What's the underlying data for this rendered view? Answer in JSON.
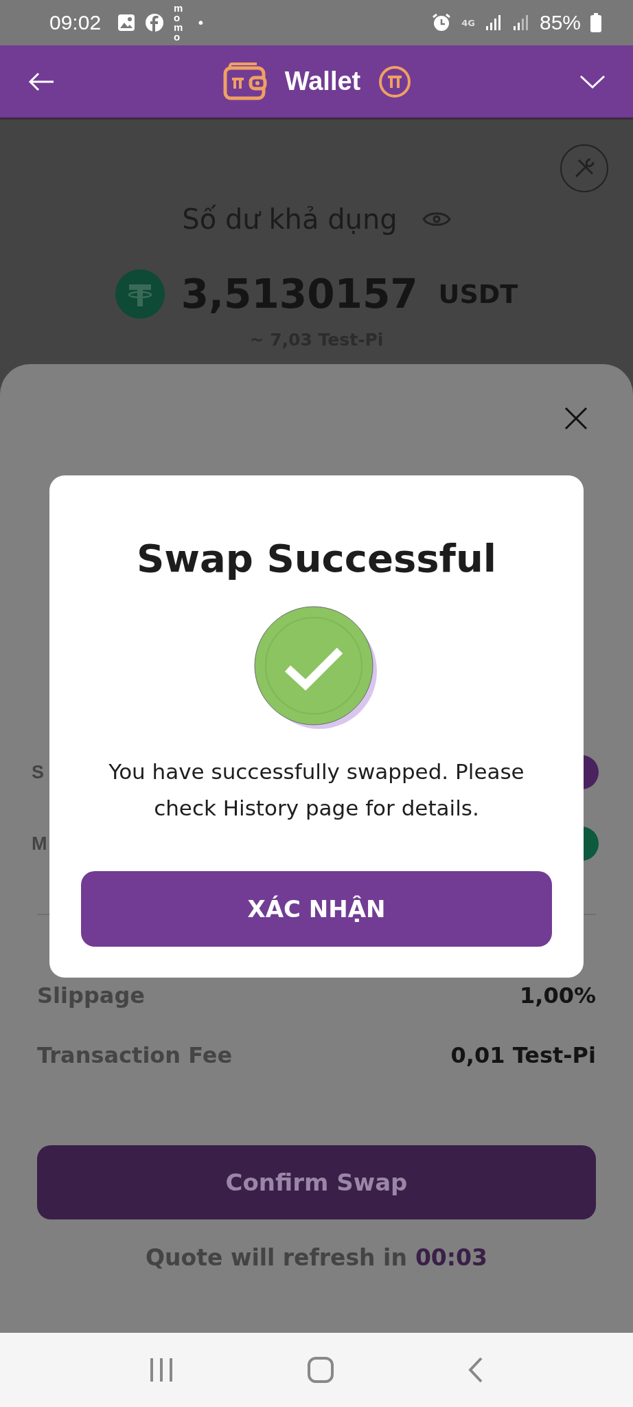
{
  "status_bar": {
    "time": "09:02",
    "app_badge": "momo",
    "dot": "•",
    "network": "4G",
    "battery": "85%"
  },
  "header": {
    "title": "Wallet"
  },
  "balance": {
    "label": "Số dư khả dụng",
    "amount": "3,5130157",
    "currency": "USDT",
    "equivalent": "~ 7,03 Test-Pi"
  },
  "swap_sheet": {
    "partial_rows": [
      {
        "label": "S",
        "color": "#4a2260"
      },
      {
        "label": "M",
        "color": "#0d5a3e"
      }
    ],
    "details": [
      {
        "label": "Slippage",
        "value": "1,00%"
      },
      {
        "label": "Transaction Fee",
        "value": "0,01 Test-Pi"
      }
    ],
    "confirm_button": "Confirm Swap",
    "refresh": {
      "text": "Quote will refresh in",
      "countdown": "00:03"
    }
  },
  "dialog": {
    "title": "Swap Successful",
    "message": "You have successfully swapped. Please check History page for details.",
    "button": "XÁC NHẬN"
  }
}
